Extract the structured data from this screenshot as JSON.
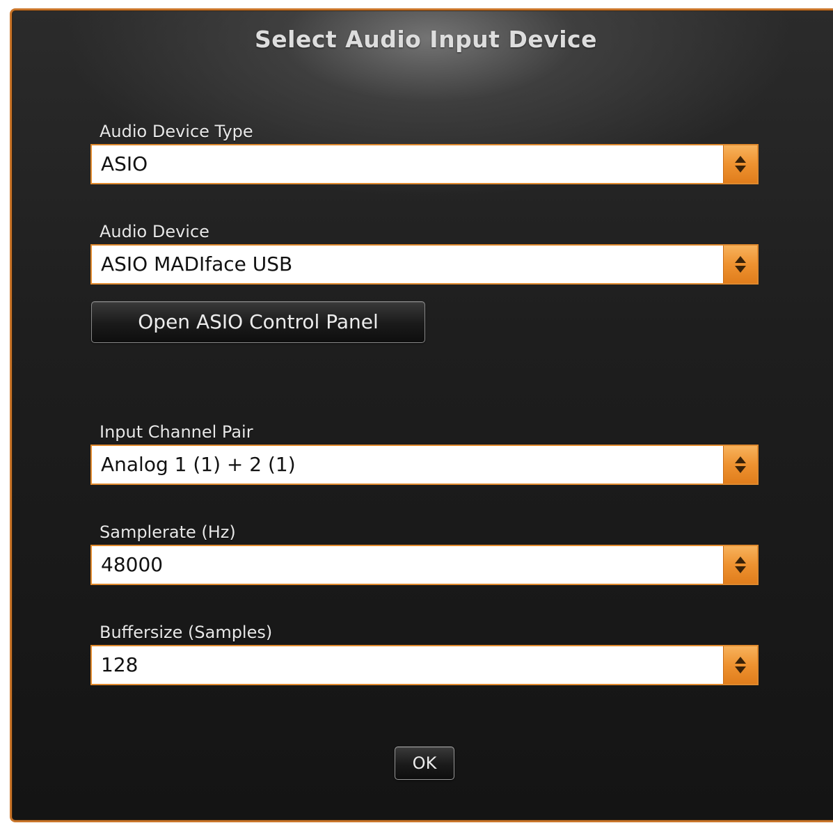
{
  "dialog": {
    "title": "Select Audio Input Device"
  },
  "fields": [
    {
      "label": "Audio Device Type",
      "value": "ASIO"
    },
    {
      "label": "Audio Device",
      "value": "ASIO MADIface USB"
    },
    {
      "label": "Input Channel Pair",
      "value": "Analog 1 (1) + 2 (1)"
    },
    {
      "label": "Samplerate (Hz)",
      "value": "48000"
    },
    {
      "label": "Buffersize (Samples)",
      "value": "128"
    }
  ],
  "buttons": {
    "asio_control_panel": "Open ASIO Control Panel",
    "ok": "OK"
  },
  "icons": {
    "select_stepper": "up-down-arrows-icon"
  },
  "colors": {
    "accent_orange": "#e08a2e",
    "dialog_background": "#1e1e1e",
    "text_light": "#e8e8e8"
  }
}
